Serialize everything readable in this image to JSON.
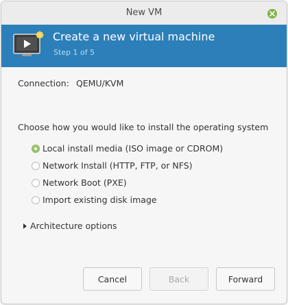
{
  "window": {
    "title": "New VM"
  },
  "header": {
    "title": "Create a new virtual machine",
    "step": "Step 1 of 5"
  },
  "connection": {
    "label": "Connection:",
    "value": "QEMU/KVM"
  },
  "install": {
    "prompt": "Choose how you would like to install the operating system",
    "selected": "Local install media (ISO image or CDROM)",
    "options": [
      {
        "label": "Local install media (ISO image or CDROM)",
        "checked": true
      },
      {
        "label": "Network Install (HTTP, FTP, or NFS)",
        "checked": false
      },
      {
        "label": "Network Boot (PXE)",
        "checked": false
      },
      {
        "label": "Import existing disk image",
        "checked": false
      }
    ]
  },
  "architecture": {
    "label": "Architecture options",
    "expanded": false
  },
  "buttons": {
    "cancel": "Cancel",
    "back": "Back",
    "forward": "Forward",
    "back_enabled": false
  },
  "colors": {
    "header_bg": "#2c7fb8",
    "accent": "#8cb85a",
    "close": "#7fb446"
  },
  "icons": {
    "close": "close-icon",
    "app": "vm-monitor-icon"
  }
}
